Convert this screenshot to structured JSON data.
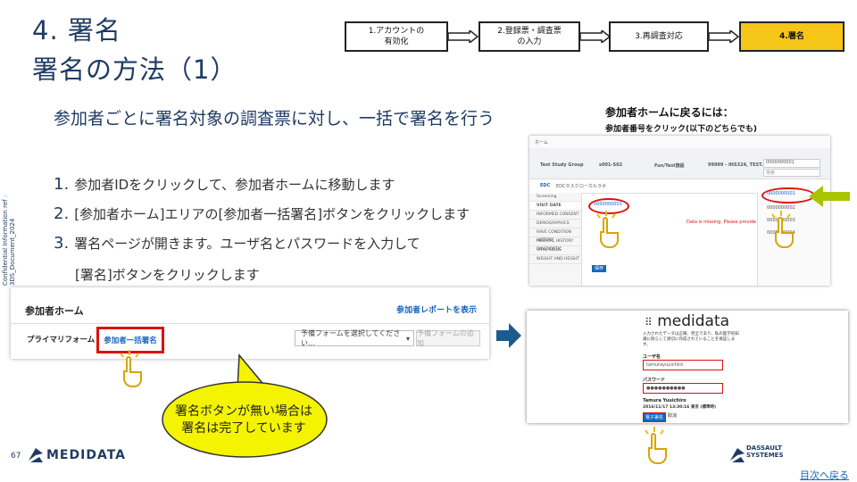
{
  "title": {
    "line1": "4. 署名",
    "line2": "署名の方法（1）"
  },
  "steps": [
    {
      "line1": "1.アカウントの",
      "line2": "有効化"
    },
    {
      "line1": "2.登録票・調査票",
      "line2": "の入力"
    },
    {
      "line1": "3.再調査対応",
      "line2": ""
    },
    {
      "line1": "4.署名",
      "line2": ""
    }
  ],
  "subtitle": "参加者ごとに署名対象の調査票に対し、一括で署名を行う",
  "instructions": [
    {
      "num": "1.",
      "text": "参加者IDをクリックして、参加者ホームに移動します"
    },
    {
      "num": "2.",
      "text": "[参加者ホーム]エリアの[参加者一括署名]ボタンをクリックします"
    },
    {
      "num": "3.",
      "text": "署名ページが開きます。ユーザ名とパスワードを入力して"
    }
  ],
  "instruction_cont": "[署名]ボタンをクリックします",
  "side_label": "Confidential Information   ref : 3DS_Document_2024",
  "participant_panel": {
    "title": "参加者ホーム",
    "report_link": "参加者レポートを表示",
    "primary_form": "プライマリフォーム",
    "bulk_sign": "参加者一括署名",
    "form_select": "予備フォームを選択してください...",
    "form_add": "予備フォームの追加"
  },
  "bubble": {
    "line1": "署名ボタンが無い場合は",
    "line2": "署名は完了しています"
  },
  "return_home": {
    "title": "参加者ホームに戻るには：",
    "sub": "参加者番号をクリック(以下のどちらでも)"
  },
  "rave": {
    "header_left": "ホーム",
    "filter_study": "Test Study Group",
    "filter_site": "s001-S02",
    "filter_form": "Fun/Test施設",
    "filter_id": "99999 - IHS324, TEST...",
    "subject_id": "0000000001",
    "search_placeholder": "検索",
    "tabs": [
      "EDC",
      "EDCタスク",
      "ローカルラボ"
    ],
    "side_items": [
      "Screening",
      "VISIT DATE",
      "INFORMED CONSENT",
      "DEMOGRAPHICS",
      "RAVE CONDITION HISTORY",
      "MEDICAL HISTORY DIAGNOSTIC",
      "VITAL SIGNS",
      "WEIGHT AND HEIGHT"
    ],
    "missing_note": "Data is missing. Please provide data",
    "subjects": [
      "0000000001",
      "0000000002",
      "0000000003",
      "0000000004"
    ],
    "save_btn": "保存"
  },
  "medidata_login": {
    "logo": "medidata",
    "desc": "入力されたデータは正確、完全であり、私の医学的知識に照らして適切に作成されていることを保証します。",
    "user_label": "ユーザ名",
    "user_value": "tamurayuuichiro",
    "pass_label": "パスワード",
    "pass_value": "●●●●●●●●●●",
    "signer_name": "Tamura Yuuichiro",
    "signer_date": "2016/11/17 13:30:16 東京 (標準時)",
    "sign_btn": "電子署名",
    "cancel_btn": "取消"
  },
  "footer": {
    "page_num": "67",
    "medidata_logo": "MEDIDATA",
    "dassault_line1": "DASSAULT",
    "dassault_line2": "SYSTEMES",
    "toc_link": "目次へ戻る"
  },
  "colors": {
    "accent_navy": "#1f3b63",
    "active_step": "#f5c518",
    "highlight_red": "#dd1111",
    "bubble_yellow": "#f4f400",
    "pointer_arrow": "#a8c400"
  }
}
